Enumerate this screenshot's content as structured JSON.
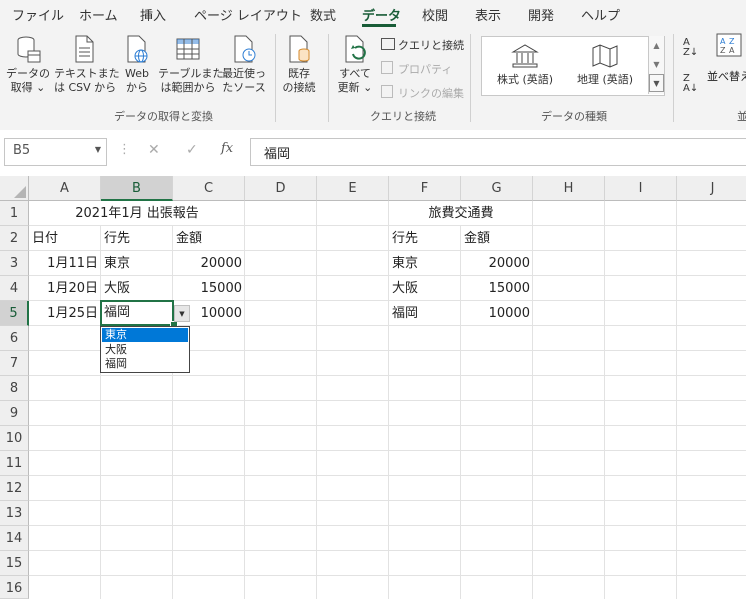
{
  "ribbon": {
    "tabs": [
      "ファイル",
      "ホーム",
      "挿入",
      "ページ レイアウト",
      "数式",
      "データ",
      "校閲",
      "表示",
      "開発",
      "ヘルプ"
    ],
    "get_data": {
      "line1": "データの",
      "line2": "取得 ⌄"
    },
    "from_text": {
      "line1": "テキストまた",
      "line2": "は CSV から"
    },
    "from_web": {
      "line1": "Web",
      "line2": "から"
    },
    "from_table": {
      "line1": "テーブルまた",
      "line2": "は範囲から"
    },
    "recent_sources": {
      "line1": "最近使っ",
      "line2": "たソース"
    },
    "existing_conn": {
      "line1": "既存",
      "line2": "の接続"
    },
    "group_get_transform": "データの取得と変換",
    "refresh_all": {
      "line1": "すべて",
      "line2": "更新 ⌄"
    },
    "queries_conn": "クエリと接続",
    "properties": "プロパティ",
    "edit_links": "リンクの編集",
    "group_queries": "クエリと接続",
    "stocks": "株式 (英語)",
    "geography": "地理 (英語)",
    "group_datatypes": "データの種類",
    "sort_label": "並べ替え",
    "group_sort": "並"
  },
  "formula_bar": {
    "name_box": "B5",
    "cancel": "✕",
    "enter": "✓",
    "fx": "fx",
    "content": "福岡"
  },
  "grid": {
    "columns": [
      "A",
      "B",
      "C",
      "D",
      "E",
      "F",
      "G",
      "H",
      "I",
      "J"
    ],
    "rows": [
      "1",
      "2",
      "3",
      "4",
      "5",
      "6",
      "7",
      "8",
      "9",
      "10",
      "11",
      "12",
      "13",
      "14",
      "15",
      "16"
    ],
    "cells": {
      "title": "2021年1月 出張報告",
      "a2": "日付",
      "b2": "行先",
      "c2": "金額",
      "a3": "1月11日",
      "b3": "東京",
      "c3": "20000",
      "a4": "1月20日",
      "b4": "大阪",
      "c4": "15000",
      "a5": "1月25日",
      "b5": "福岡",
      "c5": "10000",
      "f1": "旅費交通費",
      "f2": "行先",
      "g2": "金額",
      "f3": "東京",
      "g3": "20000",
      "f4": "大阪",
      "g4": "15000",
      "f5": "福岡",
      "g5": "10000"
    },
    "dropdown_options": [
      "東京",
      "大阪",
      "福岡"
    ],
    "dropdown_selected_index": 0
  },
  "colors": {
    "accent": "#217346",
    "selection": "#0078d7"
  }
}
